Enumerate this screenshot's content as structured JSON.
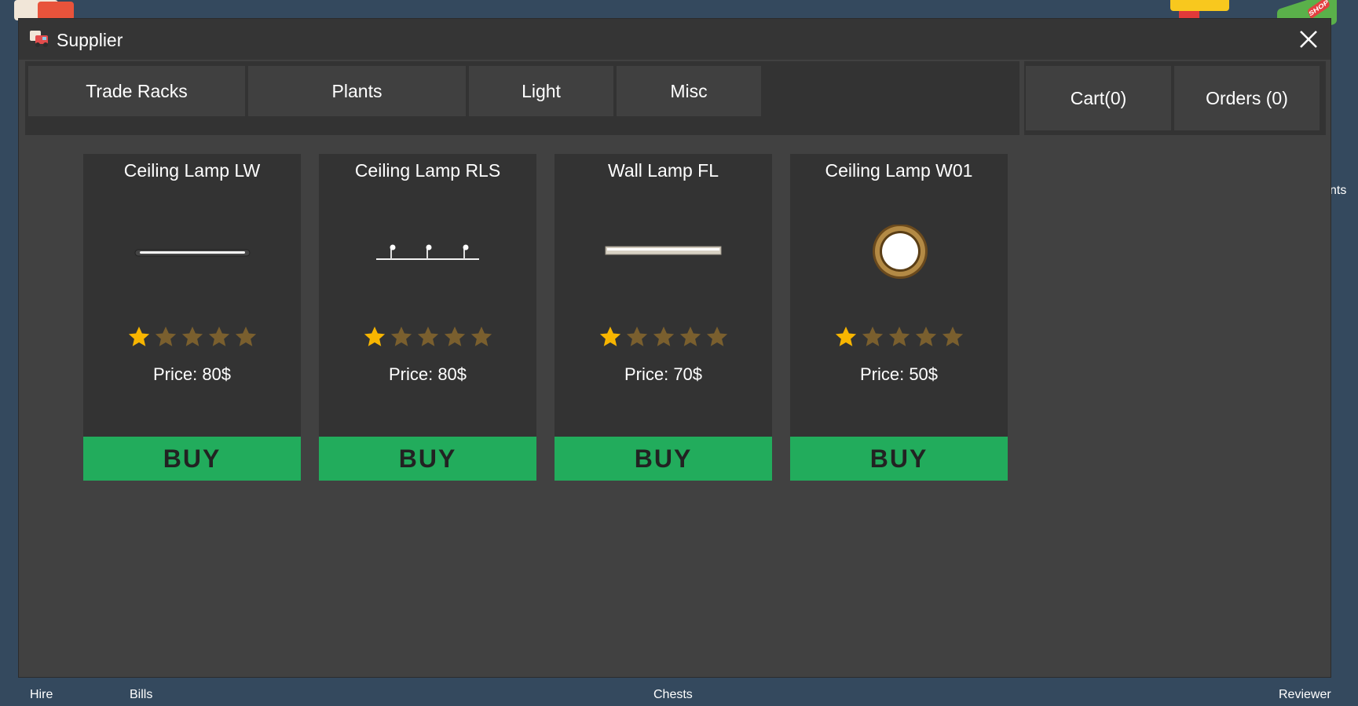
{
  "window": {
    "title": "Supplier",
    "tabs": [
      {
        "label": "Trade Racks"
      },
      {
        "label": "Plants"
      },
      {
        "label": "Light"
      },
      {
        "label": "Misc"
      }
    ],
    "cart_label": "Cart(0)",
    "orders_label": "Orders (0)"
  },
  "products": [
    {
      "name": "Ceiling Lamp LW",
      "price": "Price: 80$",
      "rating": 1,
      "max_rating": 5,
      "buy_label": "BUY",
      "icon": "ceiling-lamp-lw-icon"
    },
    {
      "name": "Ceiling Lamp RLS",
      "price": "Price: 80$",
      "rating": 1,
      "max_rating": 5,
      "buy_label": "BUY",
      "icon": "ceiling-lamp-rls-icon"
    },
    {
      "name": "Wall Lamp FL",
      "price": "Price: 70$",
      "rating": 1,
      "max_rating": 5,
      "buy_label": "BUY",
      "icon": "wall-lamp-fl-icon"
    },
    {
      "name": "Ceiling Lamp W01",
      "price": "Price: 50$",
      "rating": 1,
      "max_rating": 5,
      "buy_label": "BUY",
      "icon": "ceiling-lamp-w01-icon"
    }
  ],
  "bottom_bar": {
    "hire": "Hire",
    "bills": "Bills",
    "chests": "Chests",
    "reviewer": "Reviewer"
  },
  "side_text": "nts",
  "colors": {
    "background": "#34495e",
    "window": "#414141",
    "card": "#333333",
    "buy_button": "#22ac5c",
    "star_filled": "#f7b500",
    "star_empty": "#7a5f2e"
  }
}
